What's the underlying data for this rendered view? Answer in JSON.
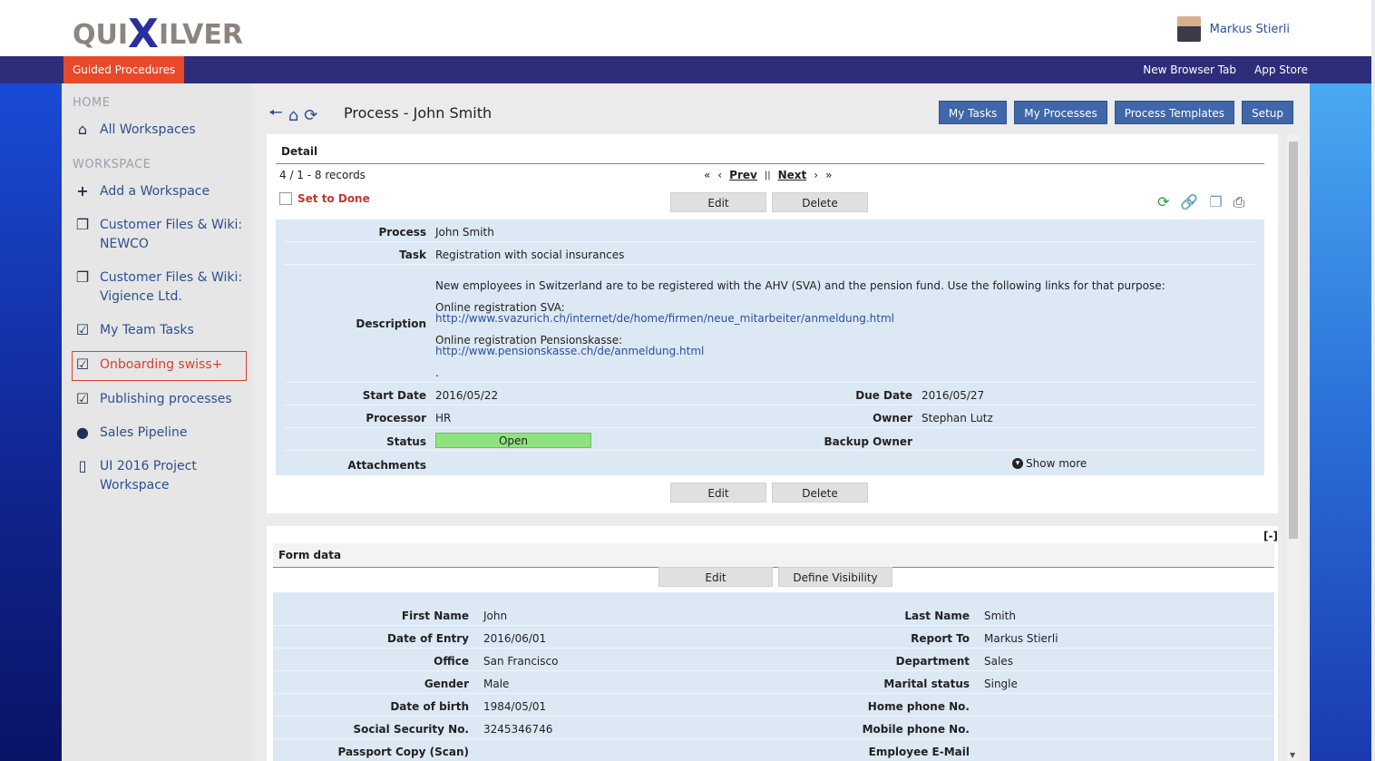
{
  "header": {
    "logo_pre": "QUI",
    "logo_x": "X",
    "logo_post": "ILVER",
    "user_name": "Markus Stierli"
  },
  "navbar": {
    "active_item": "Guided Procedures",
    "right_items": [
      "New Browser Tab",
      "App Store"
    ]
  },
  "sidebar": {
    "section_home": "HOME",
    "all_workspaces": "All Workspaces",
    "section_workspace": "WORKSPACE",
    "items": [
      {
        "label": "Add a Workspace",
        "icon": "plus-icon"
      },
      {
        "label": "Customer Files & Wiki: NEWCO",
        "icon": "files-icon"
      },
      {
        "label": "Customer Files & Wiki: Vigience Ltd.",
        "icon": "files-icon"
      },
      {
        "label": "My Team Tasks",
        "icon": "checkbox-icon"
      },
      {
        "label": "Onboarding swiss+",
        "icon": "checkbox-icon",
        "active": true
      },
      {
        "label": "Publishing processes",
        "icon": "checkbox-icon"
      },
      {
        "label": "Sales Pipeline",
        "icon": "person-icon"
      },
      {
        "label": "UI 2016 Project Workspace",
        "icon": "mobile-icon"
      }
    ]
  },
  "page": {
    "title": "Process - John Smith",
    "top_buttons": [
      "My Tasks",
      "My Processes",
      "Process Templates",
      "Setup"
    ]
  },
  "detail": {
    "header": "Detail",
    "records": "4 / 1 - 8 records",
    "pager_prev": "Prev",
    "pager_next": "Next",
    "pager_first": "«",
    "pager_last": "»",
    "pager_sep": "||",
    "set_to_done": "Set to Done",
    "edit": "Edit",
    "delete": "Delete",
    "process_label": "Process",
    "process_value": "John Smith",
    "task_label": "Task",
    "task_value": "Registration with social insurances",
    "description_label": "Description",
    "description_intro": "New employees in Switzerland are to be registered with the AHV (SVA) and the pension fund. Use the following links for that purpose:",
    "sva_label": "Online registration SVA:",
    "sva_link": "http://www.svazurich.ch/internet/de/home/firmen/neue_mitarbeiter/anmeldung.html",
    "pk_label": "Online registration Pensionskasse:",
    "pk_link": "http://www.pensionskasse.ch/de/anmeldung.html",
    "description_end": ".",
    "start_date_label": "Start Date",
    "start_date_value": "2016/05/22",
    "due_date_label": "Due Date",
    "due_date_value": "2016/05/27",
    "processor_label": "Processor",
    "processor_value": "HR",
    "owner_label": "Owner",
    "owner_value": "Stephan Lutz",
    "status_label": "Status",
    "status_value": "Open",
    "backup_owner_label": "Backup Owner",
    "attachments_label": "Attachments",
    "show_more": "Show more"
  },
  "form": {
    "collapse": "[-]",
    "header": "Form data",
    "edit": "Edit",
    "define_visibility": "Define Visibility",
    "rows": [
      {
        "l1": "First Name",
        "v1": "John",
        "l2": "Last Name",
        "v2": "Smith"
      },
      {
        "l1": "Date of Entry",
        "v1": "2016/06/01",
        "l2": "Report To",
        "v2": "Markus Stierli"
      },
      {
        "l1": "Office",
        "v1": "San Francisco",
        "l2": "Department",
        "v2": "Sales"
      },
      {
        "l1": "Gender",
        "v1": "Male",
        "l2": "Marital status",
        "v2": "Single"
      },
      {
        "l1": "Date of birth",
        "v1": "1984/05/01",
        "l2": "Home phone No.",
        "v2": ""
      },
      {
        "l1": "Social Security No.",
        "v1": "3245346746",
        "l2": "Mobile phone No.",
        "v2": ""
      },
      {
        "l1": "Passport Copy (Scan)",
        "v1": "",
        "l2": "Employee E-Mail",
        "v2": ""
      }
    ]
  },
  "colors": {
    "navbar": "#2e2d7a",
    "accent": "#e8492a",
    "link": "#2a4fa0",
    "status_open": "#8fe37f",
    "button": "#3f67a9"
  }
}
